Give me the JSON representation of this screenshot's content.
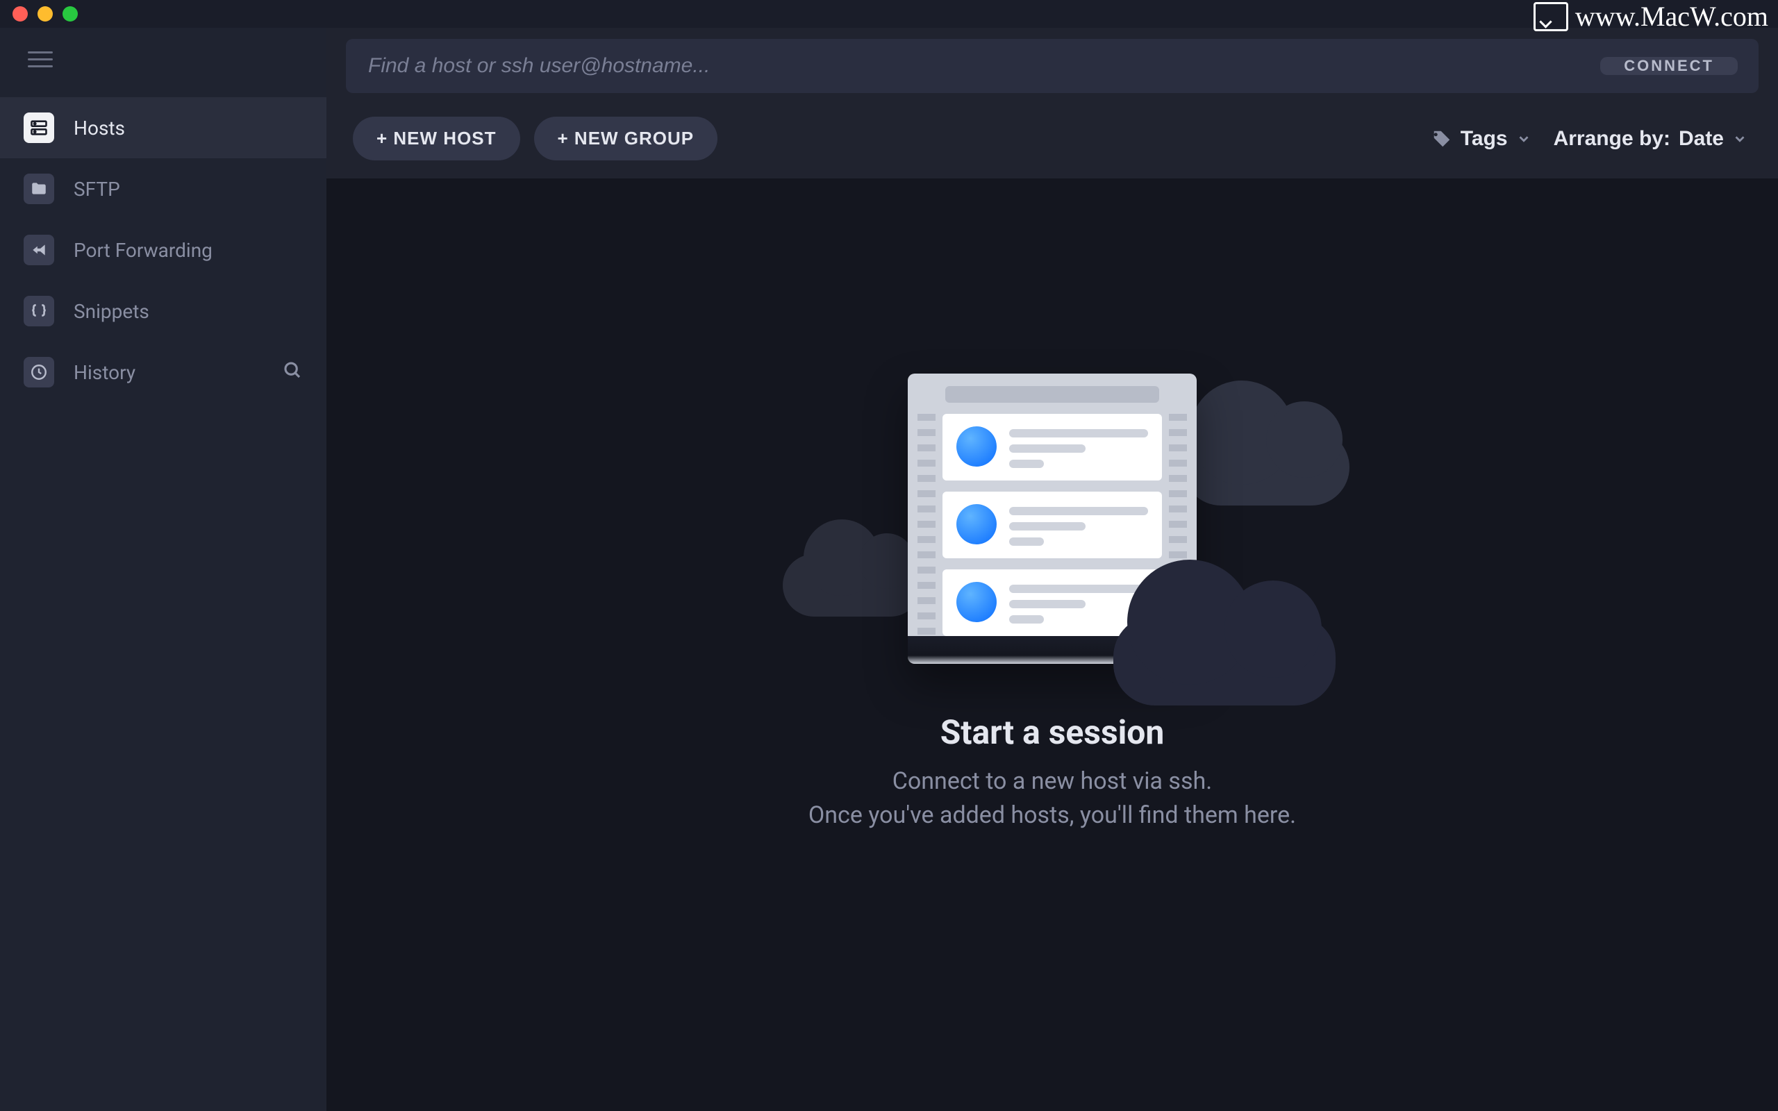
{
  "watermark": "www.MacW.com",
  "search": {
    "placeholder": "Find a host or ssh user@hostname...",
    "connect_label": "CONNECT"
  },
  "sidebar": {
    "items": [
      {
        "label": "Hosts",
        "icon": "hosts"
      },
      {
        "label": "SFTP",
        "icon": "folder"
      },
      {
        "label": "Port Forwarding",
        "icon": "forward"
      },
      {
        "label": "Snippets",
        "icon": "braces"
      },
      {
        "label": "History",
        "icon": "history"
      }
    ]
  },
  "toolbar": {
    "new_host_label": "+ NEW HOST",
    "new_group_label": "+ NEW GROUP",
    "tags_label": "Tags",
    "arrange_prefix": "Arrange by:",
    "arrange_value": "Date"
  },
  "empty": {
    "title": "Start a session",
    "line1": "Connect to a new host via ssh.",
    "line2": "Once you've added hosts, you'll find them here."
  }
}
